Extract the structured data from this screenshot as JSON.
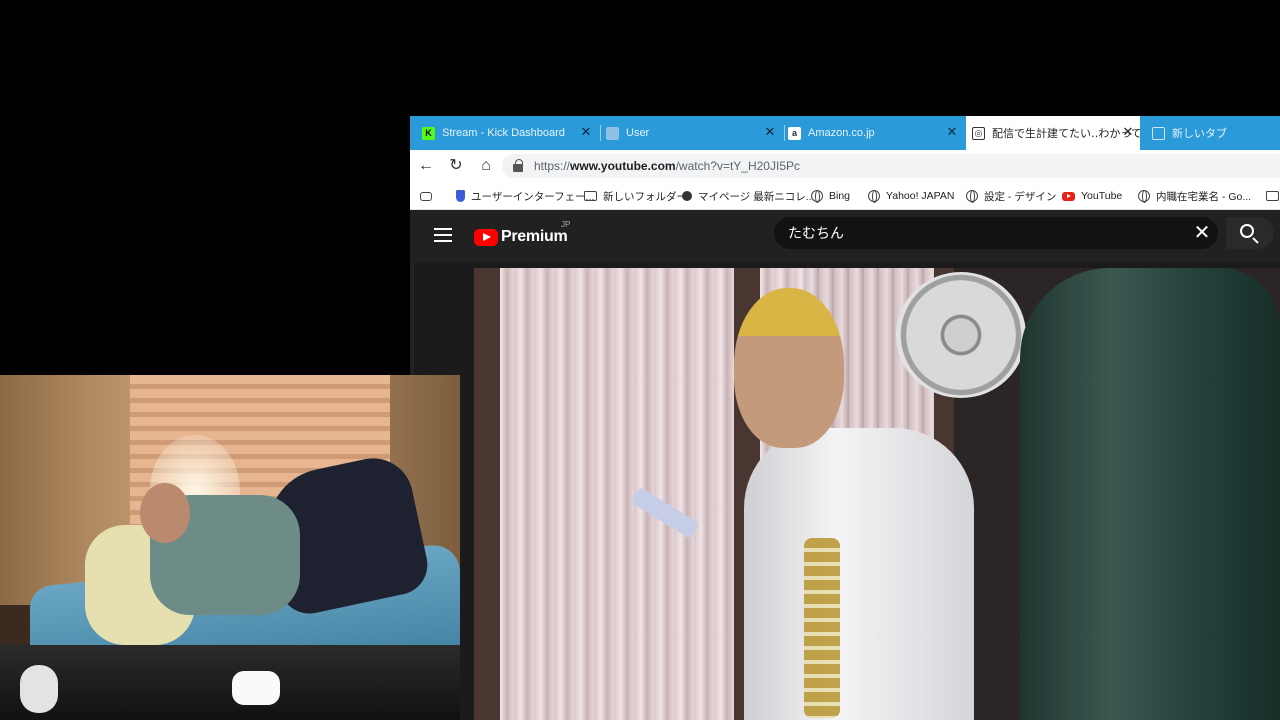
{
  "tabs": [
    {
      "label": "Stream - Kick Dashboard",
      "icon": "kick-icon",
      "color": "#53fc18"
    },
    {
      "label": "User",
      "icon": "page-icon",
      "color": "#8fc1e6"
    },
    {
      "label": "Amazon.co.jp",
      "icon": "amazon-icon",
      "color": "#ffffff"
    },
    {
      "label": "配信で生計建てたい‥わかってんの",
      "icon": "ai-chat-icon",
      "color": "#ffffff"
    },
    {
      "label": "新しいタブ",
      "icon": "new-tab-icon",
      "color": "#ffffff"
    }
  ],
  "address_bar": {
    "url_prefix": "https://",
    "url_domain": "www.youtube.com",
    "url_path": "/watch?v=tY_H20JI5Pc"
  },
  "bookmarks": [
    {
      "label": "ユーザーインターフェー...",
      "icon": "shield-icon"
    },
    {
      "label": "新しいフォルダー",
      "icon": "folder-icon"
    },
    {
      "label": "マイページ 最新ニコレ...",
      "icon": "niconico-icon"
    },
    {
      "label": "Bing",
      "icon": "globe-icon"
    },
    {
      "label": "Yahoo! JAPAN",
      "icon": "globe-icon"
    },
    {
      "label": "設定 - デザイン",
      "icon": "globe-icon"
    },
    {
      "label": "YouTube",
      "icon": "youtube-icon"
    },
    {
      "label": "内職在宅業名 - Go...",
      "icon": "globe-icon"
    }
  ],
  "youtube": {
    "logo_text": "Premium",
    "region": "JP",
    "search_query": "たむちん",
    "brand_red": "#ff0000"
  }
}
